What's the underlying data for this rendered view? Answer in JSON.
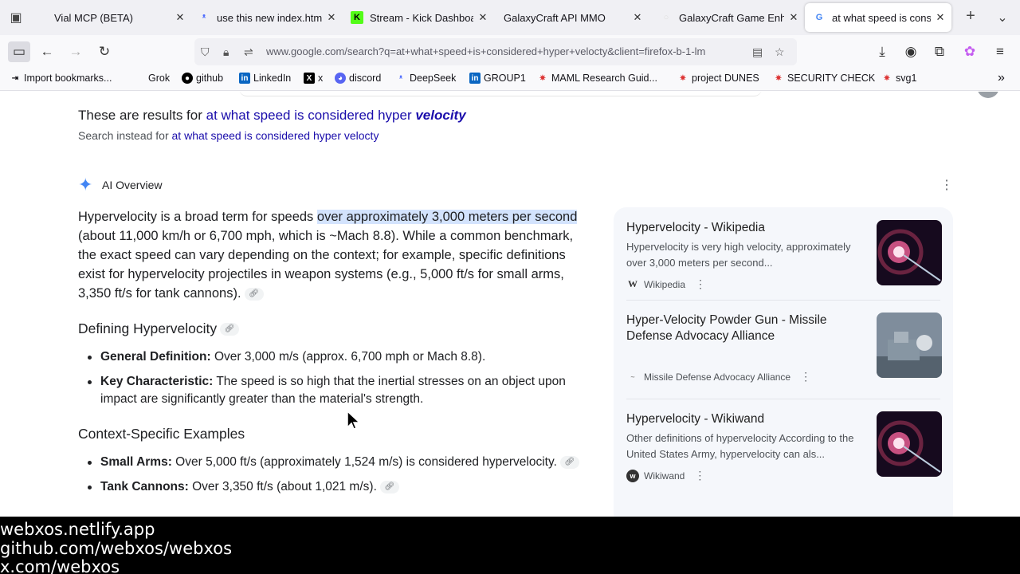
{
  "tabs": [
    {
      "title": "Vial MCP (BETA)",
      "icon": "vial-icon"
    },
    {
      "title": "use this new index.htm",
      "icon": "deepseek-icon"
    },
    {
      "title": "Stream - Kick Dashboar",
      "icon": "kick-icon"
    },
    {
      "title": "GalaxyCraft API MMO",
      "icon": "blank-icon"
    },
    {
      "title": "GalaxyCraft Game Enh",
      "icon": "blank-icon"
    },
    {
      "title": "at what speed is consid",
      "icon": "google-icon",
      "active": true
    }
  ],
  "nav": {
    "url": "www.google.com/search?q=at+what+speed+is+considered+hyper+velocty&client=firefox-b-1-lm"
  },
  "bookmarks": [
    {
      "label": "Import bookmarks...",
      "icon": "import-icon"
    },
    {
      "label": "Grok",
      "icon": "grok-icon"
    },
    {
      "label": "github",
      "icon": "github-icon"
    },
    {
      "label": "LinkedIn",
      "icon": "linkedin-icon"
    },
    {
      "label": "x",
      "icon": "x-icon"
    },
    {
      "label": "discord",
      "icon": "discord-icon"
    },
    {
      "label": "DeepSeek",
      "icon": "deepseek-icon"
    },
    {
      "label": "GROUP1",
      "icon": "linkedin-icon"
    },
    {
      "label": "MAML Research Guid...",
      "icon": "bookmark-star-icon"
    },
    {
      "label": "project DUNES",
      "icon": "bookmark-star-icon"
    },
    {
      "label": "SECURITY CHECK",
      "icon": "bookmark-star-icon"
    },
    {
      "label": "svg1",
      "icon": "bookmark-star-icon"
    }
  ],
  "search": {
    "results_prefix": "These are results for ",
    "results_query": "at what speed is considered hyper ",
    "results_corrected": "velocity",
    "instead_prefix": "Search instead for ",
    "instead_query": "at what speed is considered hyper velocty"
  },
  "ai": {
    "label": "AI Overview",
    "p1_a": "Hypervelocity is a broad term for speeds ",
    "p1_hl": "over approximately 3,000 meters per second",
    "p1_b": " (about 11,000 km/h or 6,700 mph, which is ~Mach 8.8). While a common benchmark, the exact speed can vary depending on the context; for example, specific definitions exist for hypervelocity projectiles in weapon systems (e.g., 5,000 ft/s for small arms, 3,350 ft/s for tank cannons).",
    "section1": "Defining Hypervelocity",
    "s1_items": [
      {
        "term": "General Definition:",
        "text": " Over 3,000 m/s (approx. 6,700 mph or Mach 8.8)."
      },
      {
        "term": "Key Characteristic:",
        "text": " The speed is so high that the inertial stresses on an object upon impact are significantly greater than the material's strength."
      }
    ],
    "section2": "Context-Specific Examples",
    "s2_items": [
      {
        "term": "Small Arms:",
        "text": " Over 5,000 ft/s (approximately 1,524 m/s) is considered hypervelocity."
      },
      {
        "term": "Tank Cannons:",
        "text": " Over 3,350 ft/s (about 1,021 m/s)."
      }
    ]
  },
  "sources": [
    {
      "title": "Hypervelocity - Wikipedia",
      "desc": "Hypervelocity is very high velocity, approximately over 3,000 meters per second...",
      "site": "Wikipedia",
      "fav": "W"
    },
    {
      "title": "Hyper-Velocity Powder Gun - Missile Defense Advocacy Alliance",
      "desc": "",
      "site": "Missile Defense Advocacy Alliance",
      "fav": "~"
    },
    {
      "title": "Hypervelocity - Wikiwand",
      "desc": "Other definitions of hypervelocity According to the United States Army, hypervelocity can als...",
      "site": "Wikiwand",
      "fav": "w"
    }
  ],
  "overlay": {
    "line1": "webxos.netlify.app",
    "line2": "github.com/webxos/webxos",
    "line3": "x.com/webxos"
  },
  "colors": {
    "link": "#1a0dab",
    "highlight": "#d3e3fd",
    "ai_star": "#4285f4"
  }
}
